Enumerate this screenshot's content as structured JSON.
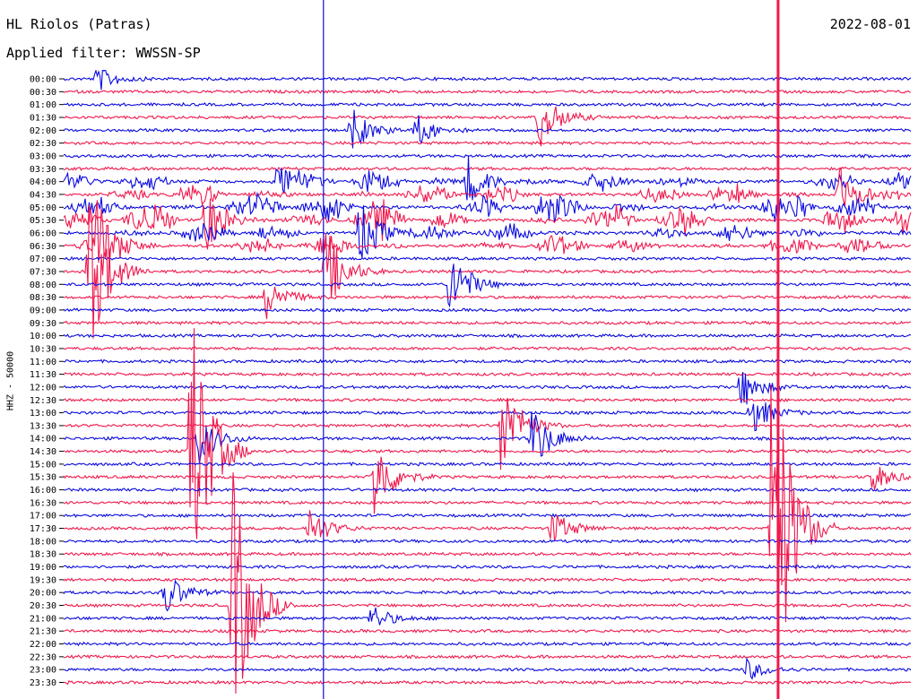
{
  "header": {
    "station": "HL Riolos (Patras)",
    "date": "2022-08-01",
    "filter_label": "Applied filter: WWSSN-SP"
  },
  "channel_label": "HHZ - 50000",
  "colors": {
    "blue": "#0a0ae0",
    "red": "#f0184c",
    "axis": "#000000"
  },
  "chart_data": {
    "type": "line",
    "title": "HL Riolos (Patras)",
    "subtitle": "Applied filter: WWSSN-SP",
    "ylabel": "HHZ - 50000",
    "xlabel": "",
    "row_labels": [
      "00:00",
      "00:30",
      "01:00",
      "01:30",
      "02:00",
      "02:30",
      "03:00",
      "03:30",
      "04:00",
      "04:30",
      "05:00",
      "05:30",
      "06:00",
      "06:30",
      "07:00",
      "07:30",
      "08:00",
      "08:30",
      "09:00",
      "09:30",
      "10:00",
      "10:30",
      "11:00",
      "11:30",
      "12:00",
      "12:30",
      "13:00",
      "13:30",
      "14:00",
      "14:30",
      "15:00",
      "15:30",
      "16:00",
      "16:30",
      "17:00",
      "17:30",
      "18:00",
      "18:30",
      "19:00",
      "19:30",
      "20:00",
      "20:30",
      "21:00",
      "21:30",
      "22:00",
      "22:30",
      "23:00",
      "23:30"
    ],
    "row_colors": [
      "blue",
      "red"
    ],
    "x_range_minutes": [
      0,
      30
    ],
    "markers_minute": [
      {
        "minute": 9.2,
        "color": "blue"
      },
      {
        "minute": 25.3,
        "color": "red"
      }
    ],
    "events": [
      {
        "row": "00:00",
        "minute": 1.2,
        "amp": 0.5,
        "color": "blue"
      },
      {
        "row": "01:30",
        "minute": 16.8,
        "amp": 1.3,
        "color": "red"
      },
      {
        "row": "02:00",
        "minute": 10.2,
        "amp": 0.8,
        "color": "blue"
      },
      {
        "row": "02:00",
        "minute": 12.5,
        "amp": 0.6,
        "color": "blue"
      },
      {
        "row": "04:00",
        "minute": 7.5,
        "amp": 0.8,
        "color": "blue"
      },
      {
        "row": "04:00",
        "minute": 14.3,
        "amp": 0.9,
        "color": "blue"
      },
      {
        "row": "04:30",
        "minute": 27.5,
        "amp": 1.0,
        "color": "red"
      },
      {
        "row": "05:30",
        "minute": 5.0,
        "amp": 1.2,
        "color": "red"
      },
      {
        "row": "06:00",
        "minute": 10.5,
        "amp": 1.3,
        "color": "blue"
      },
      {
        "row": "06:30",
        "minute": 1.2,
        "amp": 1.5,
        "color": "red"
      },
      {
        "row": "07:30",
        "minute": 0.9,
        "amp": 3.2,
        "color": "red"
      },
      {
        "row": "07:30",
        "minute": 9.3,
        "amp": 1.6,
        "color": "blue"
      },
      {
        "row": "08:00",
        "minute": 13.7,
        "amp": 1.4,
        "color": "blue"
      },
      {
        "row": "08:30",
        "minute": 7.2,
        "amp": 0.8,
        "color": "red"
      },
      {
        "row": "12:00",
        "minute": 24.0,
        "amp": 0.8,
        "color": "blue"
      },
      {
        "row": "13:00",
        "minute": 24.3,
        "amp": 0.9,
        "color": "blue"
      },
      {
        "row": "13:30",
        "minute": 15.5,
        "amp": 2.0,
        "color": "red"
      },
      {
        "row": "14:00",
        "minute": 4.8,
        "amp": 1.0,
        "color": "blue"
      },
      {
        "row": "14:00",
        "minute": 16.6,
        "amp": 1.2,
        "color": "blue"
      },
      {
        "row": "14:30",
        "minute": 4.5,
        "amp": 6.0,
        "color": "red"
      },
      {
        "row": "15:30",
        "minute": 11.0,
        "amp": 1.6,
        "color": "red"
      },
      {
        "row": "15:30",
        "minute": 28.6,
        "amp": 0.6,
        "color": "red"
      },
      {
        "row": "17:30",
        "minute": 8.7,
        "amp": 0.8,
        "color": "red"
      },
      {
        "row": "17:30",
        "minute": 17.3,
        "amp": 0.7,
        "color": "red"
      },
      {
        "row": "17:30",
        "minute": 25.1,
        "amp": 8.0,
        "color": "red"
      },
      {
        "row": "20:00",
        "minute": 3.6,
        "amp": 0.8,
        "color": "blue"
      },
      {
        "row": "20:30",
        "minute": 6.0,
        "amp": 5.0,
        "color": "red"
      },
      {
        "row": "21:00",
        "minute": 10.9,
        "amp": 0.5,
        "color": "blue"
      },
      {
        "row": "23:00",
        "minute": 24.2,
        "amp": 0.4,
        "color": "blue"
      }
    ]
  }
}
